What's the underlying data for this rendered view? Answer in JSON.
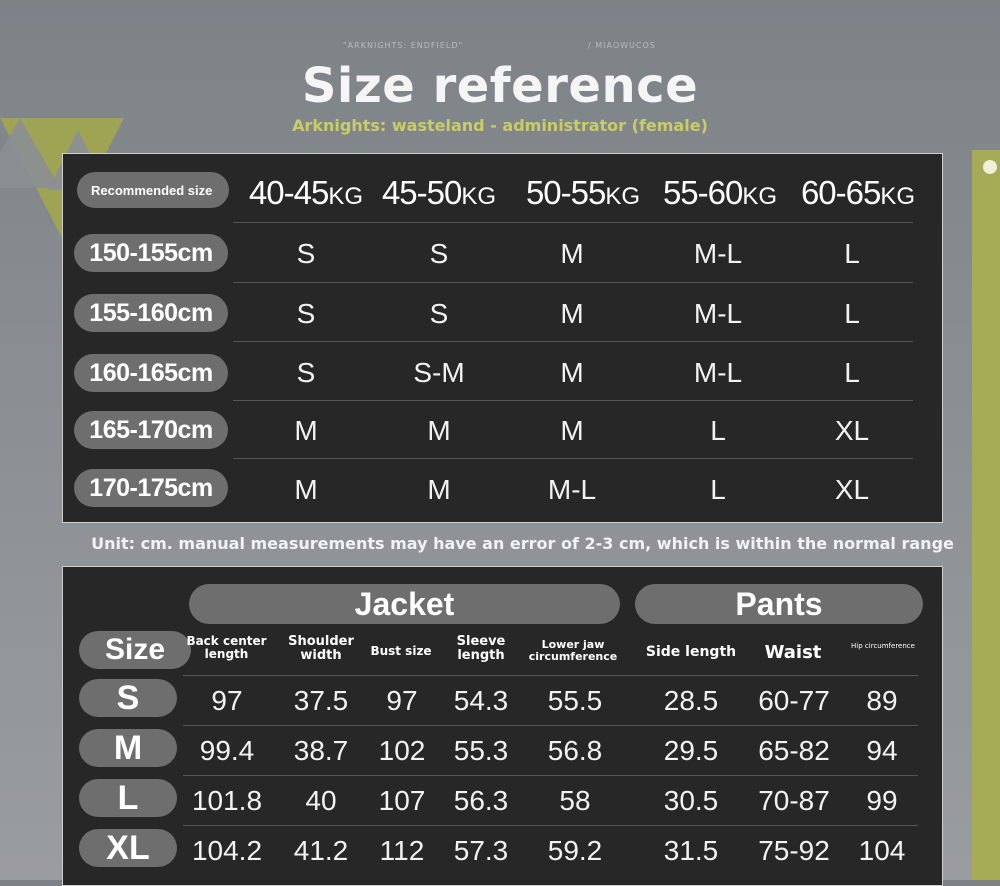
{
  "header": {
    "top_left": "\"ARKNIGHTS: ENDFIELD\"",
    "top_right": "/ MIAOWUCOS",
    "title": "Size reference",
    "subtitle": "Arknights: wasteland - administrator (female)"
  },
  "size_chart": {
    "corner_label": "Recommended size",
    "weights": [
      {
        "num": "40-45",
        "unit": "KG"
      },
      {
        "num": "45-50",
        "unit": "KG"
      },
      {
        "num": "50-55",
        "unit": "KG"
      },
      {
        "num": "55-60",
        "unit": "KG"
      },
      {
        "num": "60-65",
        "unit": "KG"
      }
    ],
    "rows": [
      {
        "height": "150-155cm",
        "sizes": [
          "S",
          "S",
          "M",
          "M-L",
          "L"
        ]
      },
      {
        "height": "155-160cm",
        "sizes": [
          "S",
          "S",
          "M",
          "M-L",
          "L"
        ]
      },
      {
        "height": "160-165cm",
        "sizes": [
          "S",
          "S-M",
          "M",
          "M-L",
          "L"
        ]
      },
      {
        "height": "165-170cm",
        "sizes": [
          "M",
          "M",
          "M",
          "L",
          "XL"
        ]
      },
      {
        "height": "170-175cm",
        "sizes": [
          "M",
          "M",
          "M-L",
          "L",
          "XL"
        ]
      }
    ]
  },
  "note": "Unit: cm. manual measurements may have an error of 2-3 cm, which is within the normal range",
  "measure_chart": {
    "size_label": "Size",
    "jacket_label": "Jacket",
    "pants_label": "Pants",
    "columns": [
      "Back center length",
      "Shoulder width",
      "Bust size",
      "Sleeve length",
      "Lower jaw circumference",
      "Side length",
      "Waist",
      "Hip circumference"
    ],
    "rows": [
      {
        "size": "S",
        "values": [
          "97",
          "37.5",
          "97",
          "54.3",
          "55.5",
          "28.5",
          "60-77",
          "89"
        ]
      },
      {
        "size": "M",
        "values": [
          "99.4",
          "38.7",
          "102",
          "55.3",
          "56.8",
          "29.5",
          "65-82",
          "94"
        ]
      },
      {
        "size": "L",
        "values": [
          "101.8",
          "40",
          "107",
          "56.3",
          "58",
          "30.5",
          "70-87",
          "99"
        ]
      },
      {
        "size": "XL",
        "values": [
          "104.2",
          "41.2",
          "112",
          "57.3",
          "59.2",
          "31.5",
          "75-92",
          "104"
        ]
      }
    ]
  }
}
